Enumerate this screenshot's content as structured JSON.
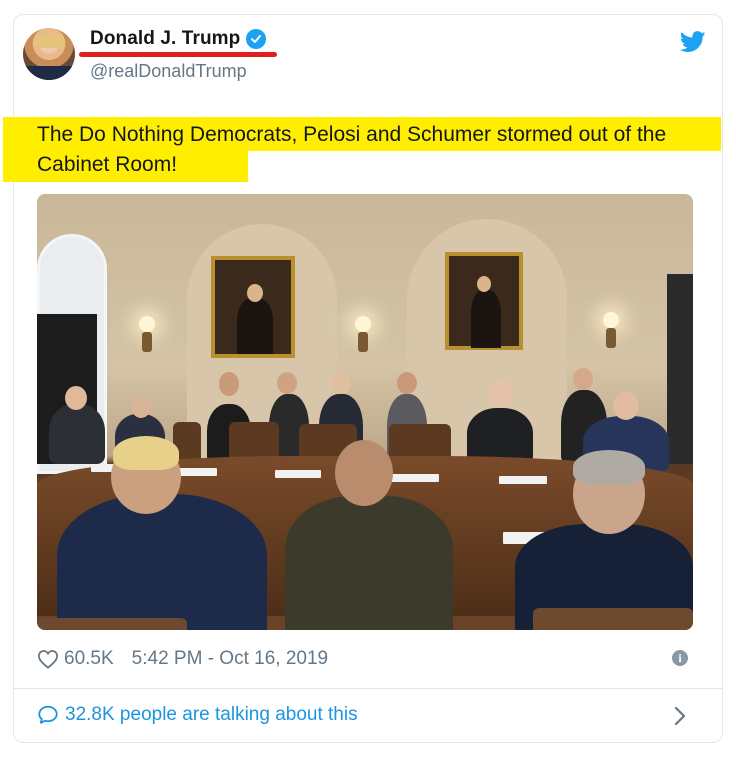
{
  "tweet": {
    "author_name": "Donald J. Trump",
    "handle": "@realDonaldTrump",
    "text": "The Do Nothing Democrats, Pelosi and Schumer stormed out of the Cabinet Room!",
    "likes": "60.5K",
    "timestamp": "5:42 PM - Oct 16, 2019",
    "talking": "32.8K people are talking about this"
  },
  "icons": {
    "verified": "verified-badge-icon",
    "brand": "twitter-bird-icon",
    "like": "heart-icon",
    "info": "info-icon",
    "reply": "speech-bubble-icon",
    "more": "chevron-right-icon"
  },
  "colors": {
    "brand_blue": "#1da1f2",
    "link_blue": "#1b95e0",
    "highlight": "#ffee00",
    "underline_mark": "#e0201e",
    "secondary_text": "#657786"
  }
}
